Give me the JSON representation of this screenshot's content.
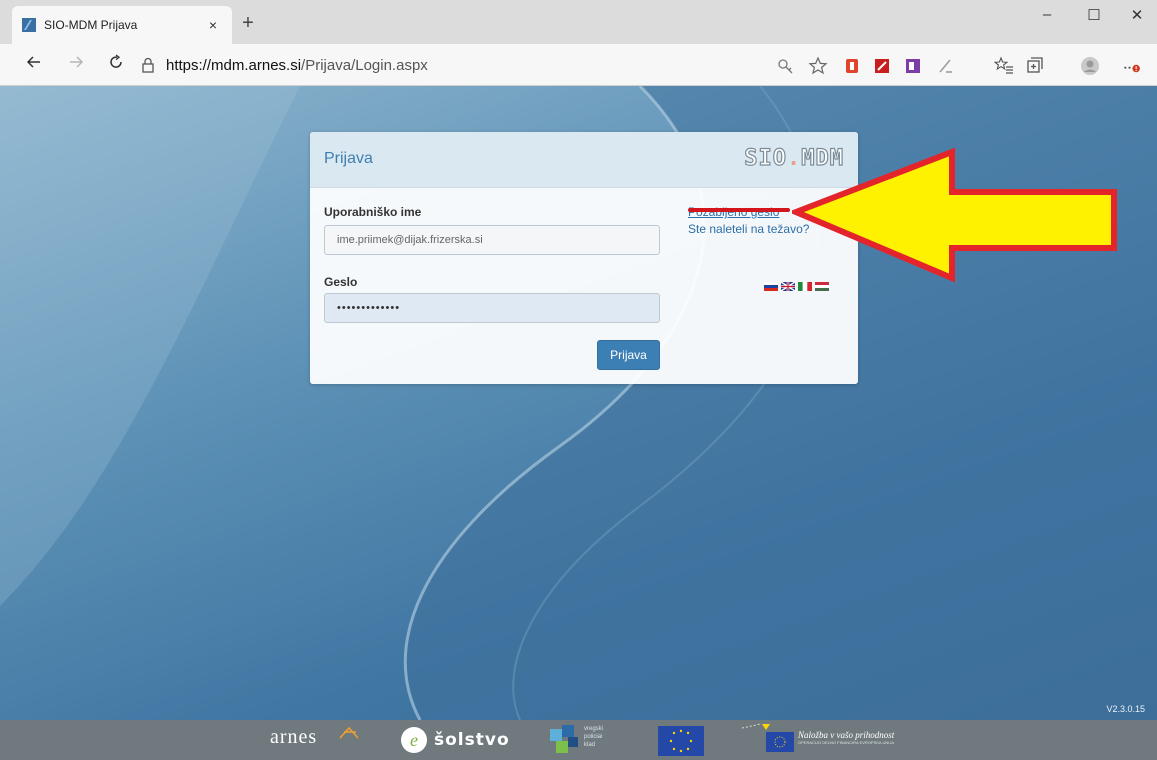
{
  "browser": {
    "tab_title": "SIO-MDM Prijava",
    "tab_close": "×",
    "new_tab": "+",
    "url_host": "https://mdm.arnes.si",
    "url_path": "/Prijava/Login.aspx",
    "win_minimize": "–",
    "win_maximize": "☐",
    "win_close": "✕"
  },
  "login": {
    "heading": "Prijava",
    "brand_a": "SIO",
    "brand_dot": ".",
    "brand_b": "MDM",
    "username_label": "Uporabniško ime",
    "username_value": "ime.priimek@dijak.frizerska.si",
    "password_label": "Geslo",
    "password_value": "•••••••••••••",
    "submit_label": "Prijava",
    "forgot_link": "Pozabljeno geslo",
    "trouble_link": "Ste naleteli na težavo?"
  },
  "footer": {
    "arnes": "arnes",
    "solstvo": "šolstvo",
    "regional_a": "vregski",
    "regional_b": "policiai",
    "regional_c": "klad",
    "naloz_title": "Naložba v vašo prihodnost",
    "naloz_sub": "OPERACIJO DELNO FINANCIRA EVROPSKA UNIJA"
  },
  "version": "V2.3.0.15",
  "colors": {
    "accent": "#3c7fb5",
    "link": "#2d6ea8",
    "arrow_fill": "#fff200",
    "arrow_stroke": "#e3242b"
  }
}
